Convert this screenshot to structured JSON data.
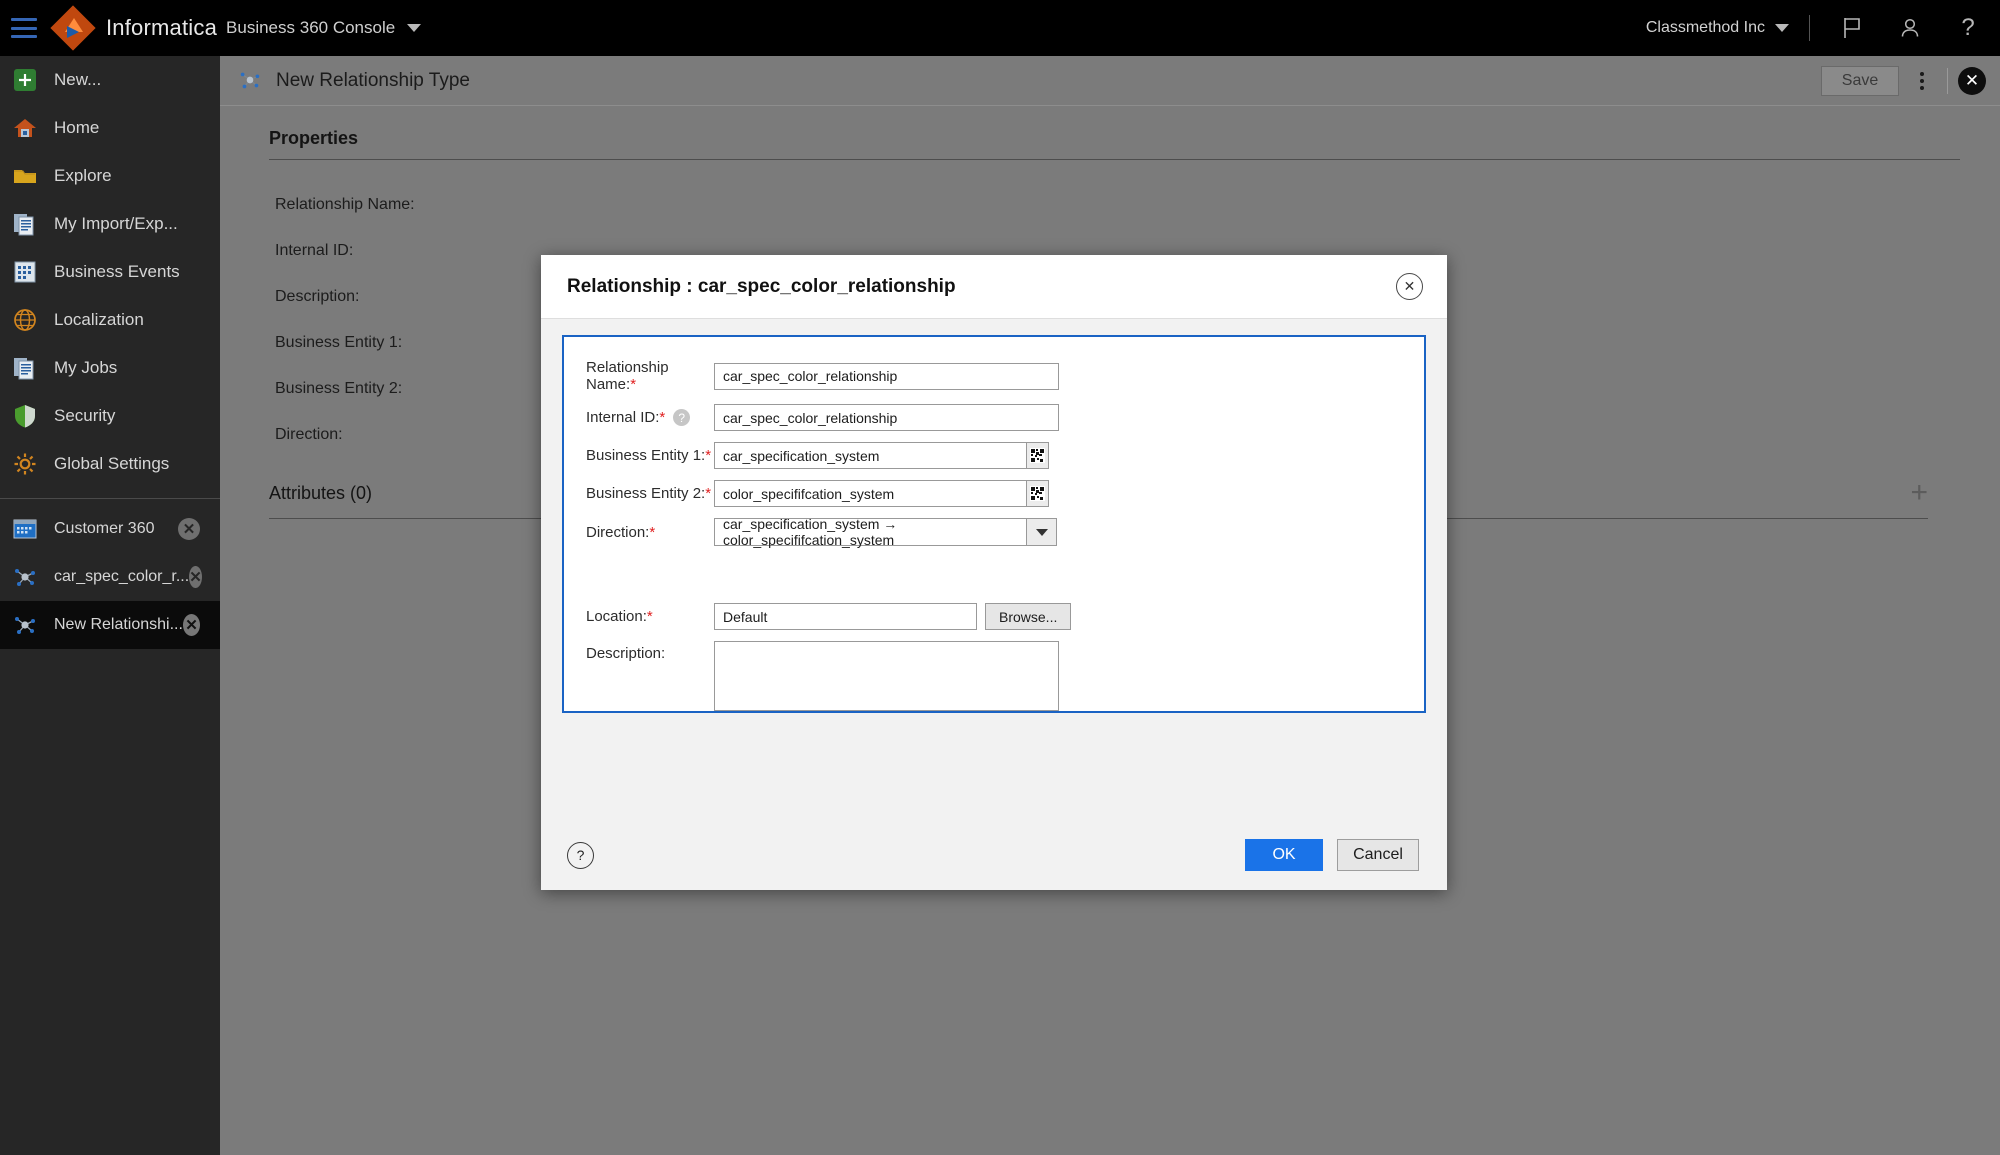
{
  "header": {
    "menu_icon": "hamburger-icon",
    "brand": "Informatica",
    "product": "Business 360 Console",
    "product_caret": "chevron-down-icon",
    "org": "Classmethod Inc",
    "org_caret": "chevron-down-icon",
    "icons": [
      "flag-icon",
      "user-icon",
      "help-icon"
    ]
  },
  "sidebar": {
    "items": [
      {
        "label": "New...",
        "icon": "plus-square-icon"
      },
      {
        "label": "Home",
        "icon": "home-icon"
      },
      {
        "label": "Explore",
        "icon": "folder-icon"
      },
      {
        "label": "My Import/Exp...",
        "icon": "documents-icon"
      },
      {
        "label": "Business Events",
        "icon": "events-grid-icon"
      },
      {
        "label": "Localization",
        "icon": "globe-icon"
      },
      {
        "label": "My Jobs",
        "icon": "documents-icon"
      },
      {
        "label": "Security",
        "icon": "shield-icon"
      },
      {
        "label": "Global Settings",
        "icon": "gear-icon"
      }
    ],
    "tabs": [
      {
        "label": "Customer 360",
        "icon": "window-grid-icon",
        "active": false,
        "close": "close-icon"
      },
      {
        "label": "car_spec_color_r...",
        "icon": "relationship-icon",
        "active": false,
        "close": "close-icon"
      },
      {
        "label": "New Relationshi...",
        "icon": "relationship-icon",
        "active": true,
        "close": "close-icon"
      }
    ]
  },
  "page": {
    "icon": "relationship-icon",
    "title": "New Relationship Type",
    "save_label": "Save",
    "kebab_icon": "more-vertical-icon",
    "close_icon": "close-circle-icon"
  },
  "properties": {
    "section_title": "Properties",
    "fields": [
      "Relationship Name:",
      "Internal ID:",
      "Description:",
      "Business Entity 1:",
      "Business Entity 2:",
      "Direction:"
    ],
    "attributes_title": "Attributes (0)",
    "add_icon": "plus-icon"
  },
  "modal": {
    "title": "Relationship : car_spec_color_relationship",
    "close_icon": "close-icon",
    "fields": {
      "relationship_name": {
        "label": "Relationship Name:",
        "required": "*",
        "value": "car_spec_color_relationship"
      },
      "internal_id": {
        "label": "Internal ID:",
        "required": "*",
        "help_icon": "question-circle-icon",
        "value": "car_spec_color_relationship"
      },
      "business_entity_1": {
        "label": "Business Entity 1:",
        "required": "*",
        "value": "car_specification_system",
        "picker_icon": "grid-picker-icon"
      },
      "business_entity_2": {
        "label": "Business Entity 2:",
        "required": "*",
        "value": "color_specififcation_system",
        "picker_icon": "grid-picker-icon"
      },
      "direction": {
        "label": "Direction:",
        "required": "*",
        "value": "car_specification_system → color_specififcation_system",
        "dropdown_icon": "chevron-down-icon"
      },
      "location": {
        "label": "Location:",
        "required": "*",
        "value": "Default",
        "browse_label": "Browse..."
      },
      "description": {
        "label": "Description:",
        "value": "",
        "placeholder": ""
      }
    },
    "footer": {
      "help_icon": "question-circle-icon",
      "ok_label": "OK",
      "cancel_label": "Cancel"
    }
  },
  "colors": {
    "accent_blue": "#1a73e8",
    "form_border_blue": "#1a63c4",
    "required_red": "#e02020",
    "topbar_black": "#000000",
    "sidebar_dark": "#262626",
    "content_gray": "#7b7b7b"
  }
}
